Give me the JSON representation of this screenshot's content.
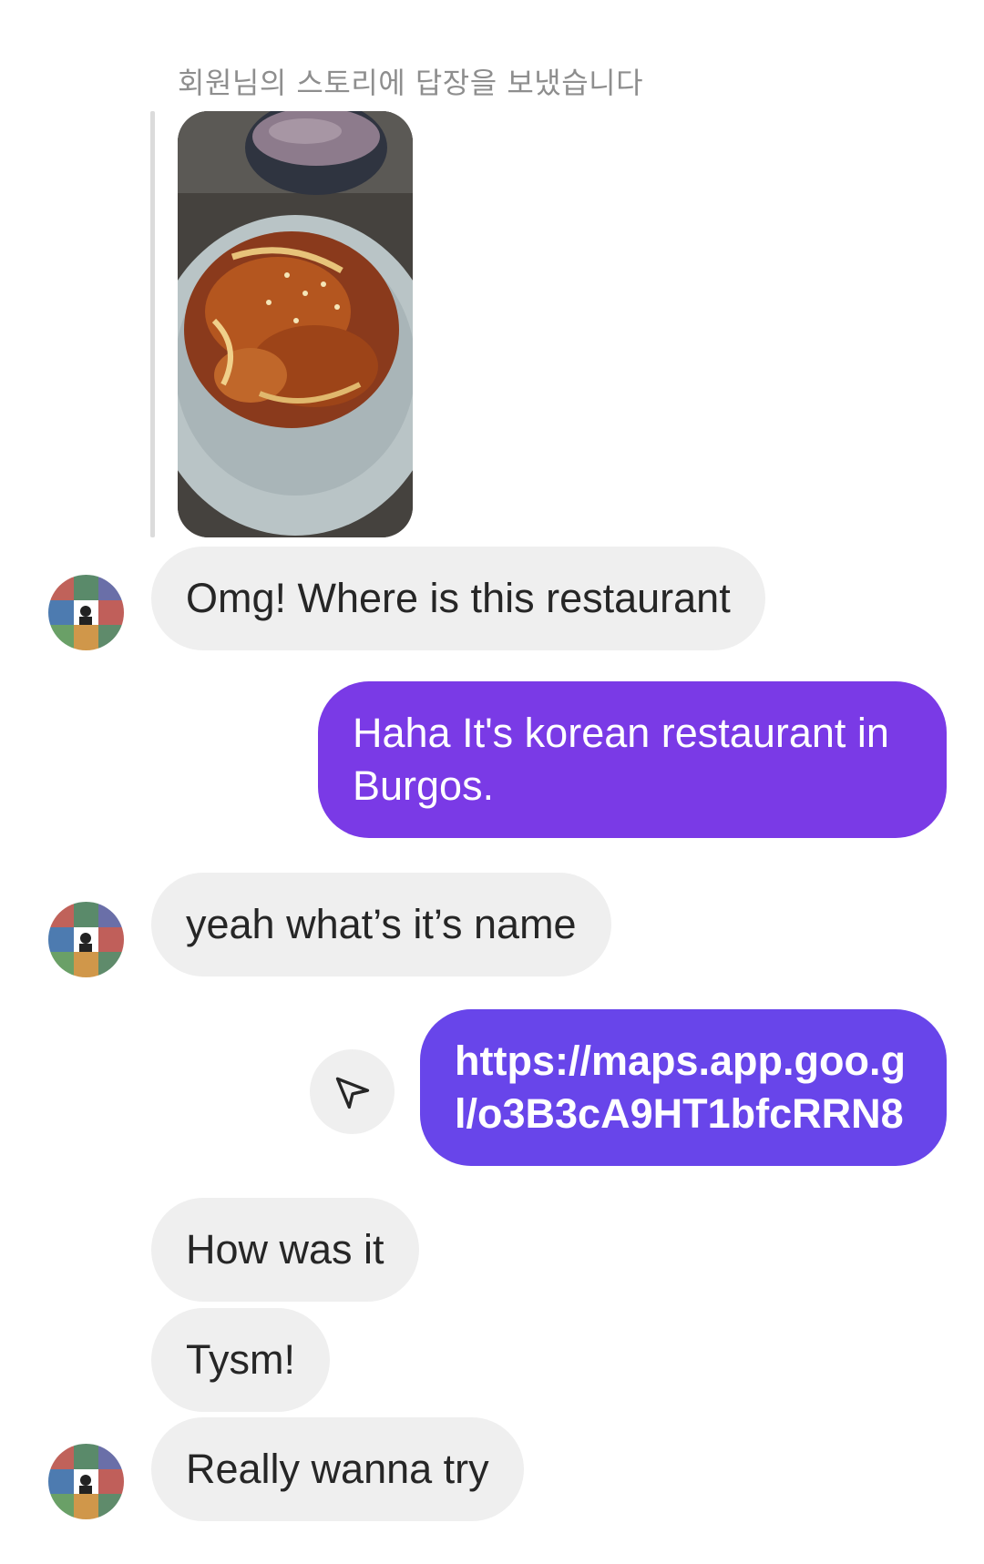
{
  "story_reply": {
    "caption": "회원님의 스토리에 답장을 보냈습니다",
    "thumbnail_icon": "story-food-photo"
  },
  "messages": [
    {
      "side": "incoming",
      "text": "Omg! Where is this restaurant",
      "avatar": true
    },
    {
      "side": "outgoing",
      "text": "Haha It's korean restaurant in Burgos."
    },
    {
      "side": "incoming",
      "text": "yeah what’s it’s name",
      "avatar": true
    },
    {
      "side": "outgoing",
      "text": "https://maps.app.goo.gl/o3B3cA9HT1bfcRRN8",
      "is_link": true
    },
    {
      "side": "incoming",
      "text": "How was it"
    },
    {
      "side": "incoming",
      "text": "Tysm!"
    },
    {
      "side": "incoming",
      "text": "Really wanna try",
      "avatar": true
    }
  ],
  "icons": {
    "avatar": "avatar-icon",
    "share": "send-icon"
  },
  "colors": {
    "incoming_bubble": "#efefef",
    "outgoing_bubble_1": "#7a3ae6",
    "outgoing_bubble_2": "#6845ea",
    "caption": "#8e8e8e"
  }
}
